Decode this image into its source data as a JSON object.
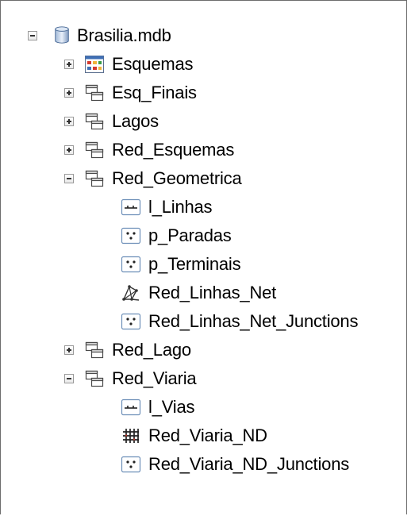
{
  "tree": {
    "root": {
      "label": "Brasilia.mdb",
      "icon": "database-icon",
      "expanded": true
    },
    "items": [
      {
        "label": "Esquemas",
        "icon": "schematic-dataset-icon",
        "expander": "plus"
      },
      {
        "label": "Esq_Finais",
        "icon": "feature-dataset-icon",
        "expander": "plus"
      },
      {
        "label": "Lagos",
        "icon": "feature-dataset-icon",
        "expander": "plus"
      },
      {
        "label": "Red_Esquemas",
        "icon": "feature-dataset-icon",
        "expander": "plus"
      },
      {
        "label": "Red_Geometrica",
        "icon": "feature-dataset-icon",
        "expander": "minus",
        "children": [
          {
            "label": "l_Linhas",
            "icon": "line-feature-class-icon"
          },
          {
            "label": "p_Paradas",
            "icon": "point-feature-class-icon"
          },
          {
            "label": "p_Terminais",
            "icon": "point-feature-class-icon"
          },
          {
            "label": "Red_Linhas_Net",
            "icon": "geometric-network-icon"
          },
          {
            "label": "Red_Linhas_Net_Junctions",
            "icon": "point-feature-class-icon"
          }
        ]
      },
      {
        "label": "Red_Lago",
        "icon": "feature-dataset-icon",
        "expander": "plus"
      },
      {
        "label": "Red_Viaria",
        "icon": "feature-dataset-icon",
        "expander": "minus",
        "children": [
          {
            "label": "l_Vias",
            "icon": "line-feature-class-icon"
          },
          {
            "label": "Red_Viaria_ND",
            "icon": "network-dataset-icon"
          },
          {
            "label": "Red_Viaria_ND_Junctions",
            "icon": "point-feature-class-icon"
          }
        ]
      }
    ]
  }
}
